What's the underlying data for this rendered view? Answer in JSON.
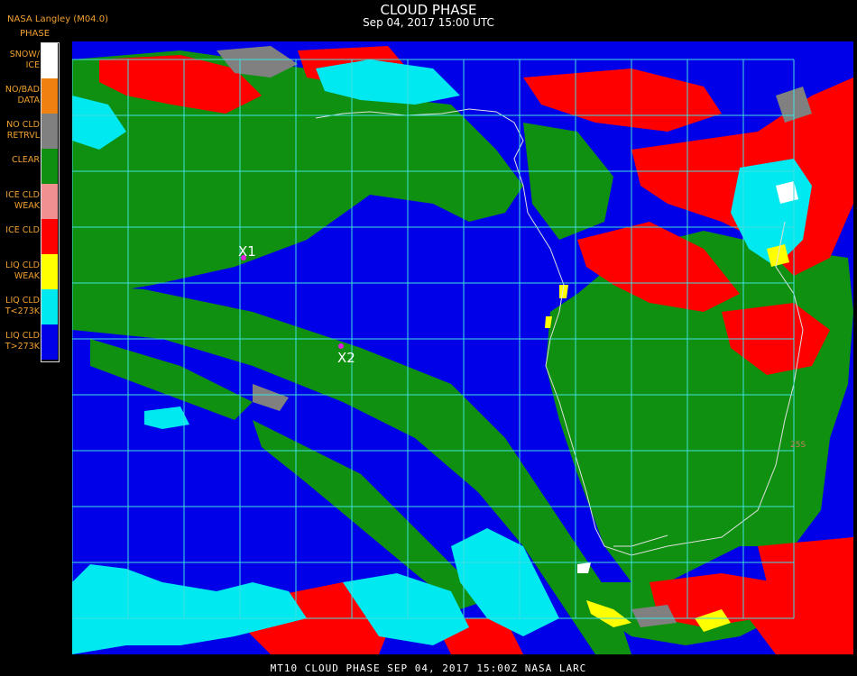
{
  "header": {
    "title": "CLOUD PHASE",
    "datetime": "Sep 04, 2017 15:00 UTC",
    "org": "NASA Langley (M04.0)",
    "legend_title": "PHASE"
  },
  "legend": [
    {
      "label": "SNOW/\nICE",
      "color": "#ffffff"
    },
    {
      "label": "NO/BAD\nDATA",
      "color": "#f08010"
    },
    {
      "label": "NO CLD\nRETRVL",
      "color": "#808080"
    },
    {
      "label": "CLEAR",
      "color": "#109010"
    },
    {
      "label": "ICE CLD\nWEAK",
      "color": "#f09090"
    },
    {
      "label": "ICE CLD",
      "color": "#ff0000"
    },
    {
      "label": "LIQ CLD\nWEAK",
      "color": "#ffff00"
    },
    {
      "label": "LIQ CLD\nT<273K",
      "color": "#00e8f0"
    },
    {
      "label": "LIQ CLD\nT>273K",
      "color": "#0000e8"
    }
  ],
  "markers": [
    {
      "label": "X1"
    },
    {
      "label": "X2"
    }
  ],
  "map_labels": [
    "25S"
  ],
  "footer": "MT10   CLOUD PHASE   SEP 04, 2017 15:00Z   NASA LARC"
}
